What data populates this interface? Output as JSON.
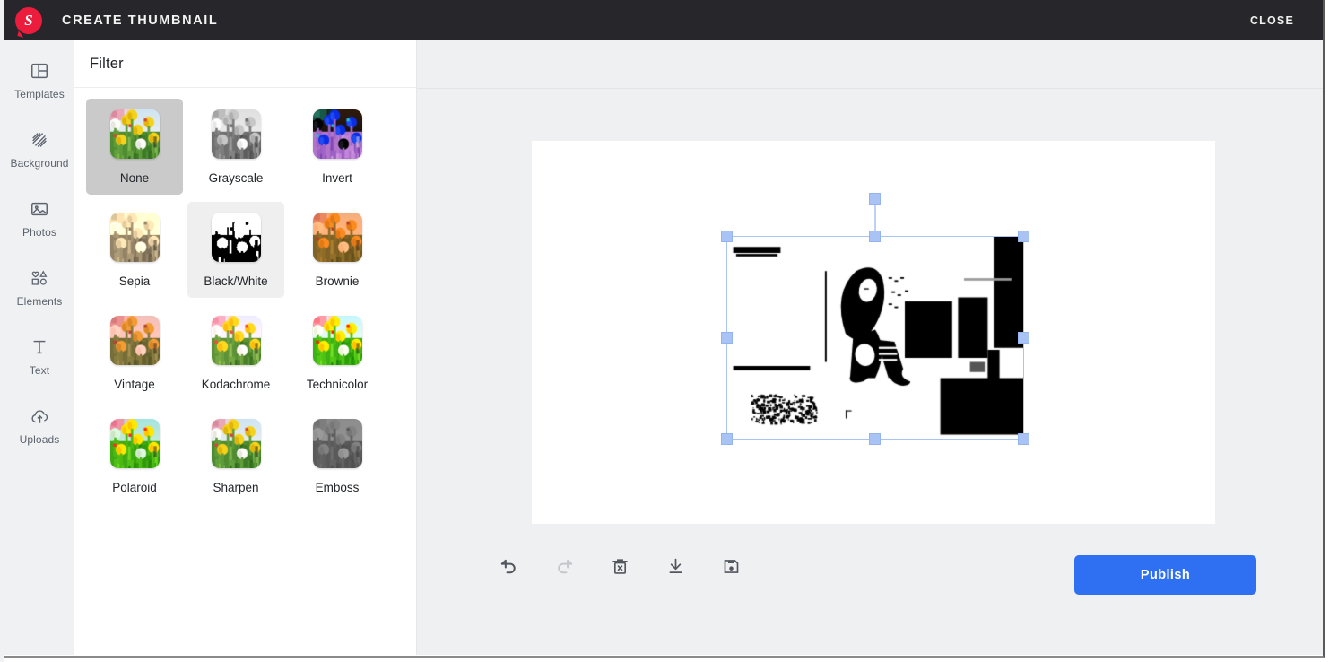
{
  "header": {
    "title": "CREATE THUMBNAIL",
    "logo_letter": "S",
    "logo_icon": "snapchat-style-bubble-logo",
    "close_label": "CLOSE",
    "background": "#26262b"
  },
  "sidebar": {
    "items": [
      {
        "label": "Templates",
        "icon": "layout-template-icon"
      },
      {
        "label": "Background",
        "icon": "hatch-pattern-icon"
      },
      {
        "label": "Photos",
        "icon": "image-icon"
      },
      {
        "label": "Elements",
        "icon": "shapes-icon"
      },
      {
        "label": "Text",
        "icon": "text-t-icon"
      },
      {
        "label": "Uploads",
        "icon": "cloud-upload-icon"
      }
    ]
  },
  "panel": {
    "title": "Filter",
    "filters": [
      {
        "label": "None",
        "state": "selected"
      },
      {
        "label": "Grayscale",
        "state": "default"
      },
      {
        "label": "Invert",
        "state": "default"
      },
      {
        "label": "Sepia",
        "state": "default"
      },
      {
        "label": "Black/White",
        "state": "hover"
      },
      {
        "label": "Brownie",
        "state": "default"
      },
      {
        "label": "Vintage",
        "state": "default"
      },
      {
        "label": "Kodachrome",
        "state": "default"
      },
      {
        "label": "Technicolor",
        "state": "default"
      },
      {
        "label": "Polaroid",
        "state": "default"
      },
      {
        "label": "Sharpen",
        "state": "default"
      },
      {
        "label": "Emboss",
        "state": "default"
      }
    ]
  },
  "stage": {
    "selected_object": "photo-black-and-white-filtered",
    "toolbar": [
      {
        "name": "undo",
        "icon": "undo-arrow-icon",
        "state": "enabled"
      },
      {
        "name": "redo",
        "icon": "redo-arrow-icon",
        "state": "disabled"
      },
      {
        "name": "delete",
        "icon": "trash-x-icon",
        "state": "enabled"
      },
      {
        "name": "download",
        "icon": "download-arrow-icon",
        "state": "enabled"
      },
      {
        "name": "save",
        "icon": "floppy-disk-icon",
        "state": "enabled"
      }
    ],
    "publish_label": "Publish",
    "publish_color": "#2f70f2",
    "background": "#eef0f2",
    "artboard_color": "#ffffff",
    "selection_handle_color": "#a8c3f4"
  }
}
